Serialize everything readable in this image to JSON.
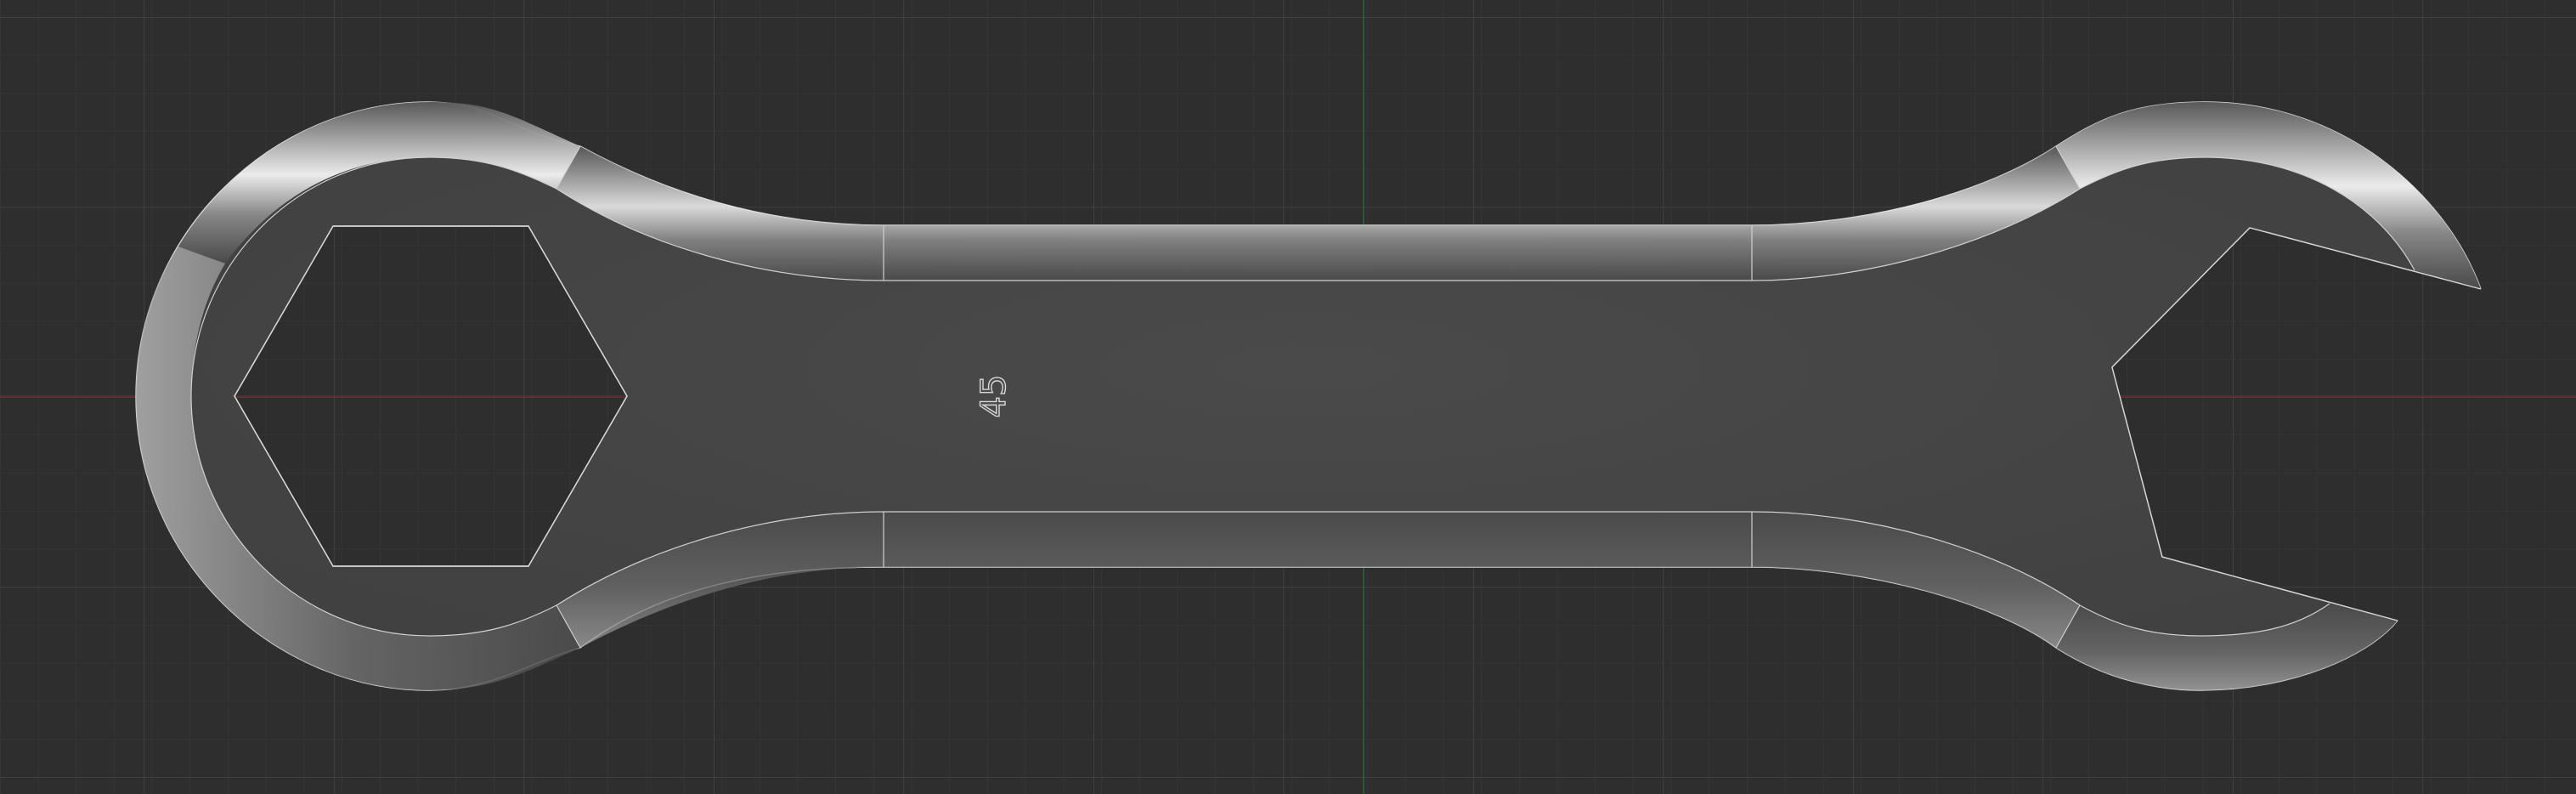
{
  "viewport": {
    "background_color": "#2e2e2e",
    "grid_minor_color": "#3a3a3a",
    "grid_major_color": "#4a4a4a",
    "x_axis_color": "#7a2a2a",
    "y_axis_color": "#2a6a3a",
    "grid_visible": true
  },
  "model": {
    "part_name": "double-ended-wrench",
    "engraved_text": "45",
    "body_color": "#454545",
    "edge_color": "#d8d8d8",
    "rim_highlight_color": "#f2f2f2",
    "left_end": "hexagon-box-end",
    "right_end": "open-end"
  }
}
